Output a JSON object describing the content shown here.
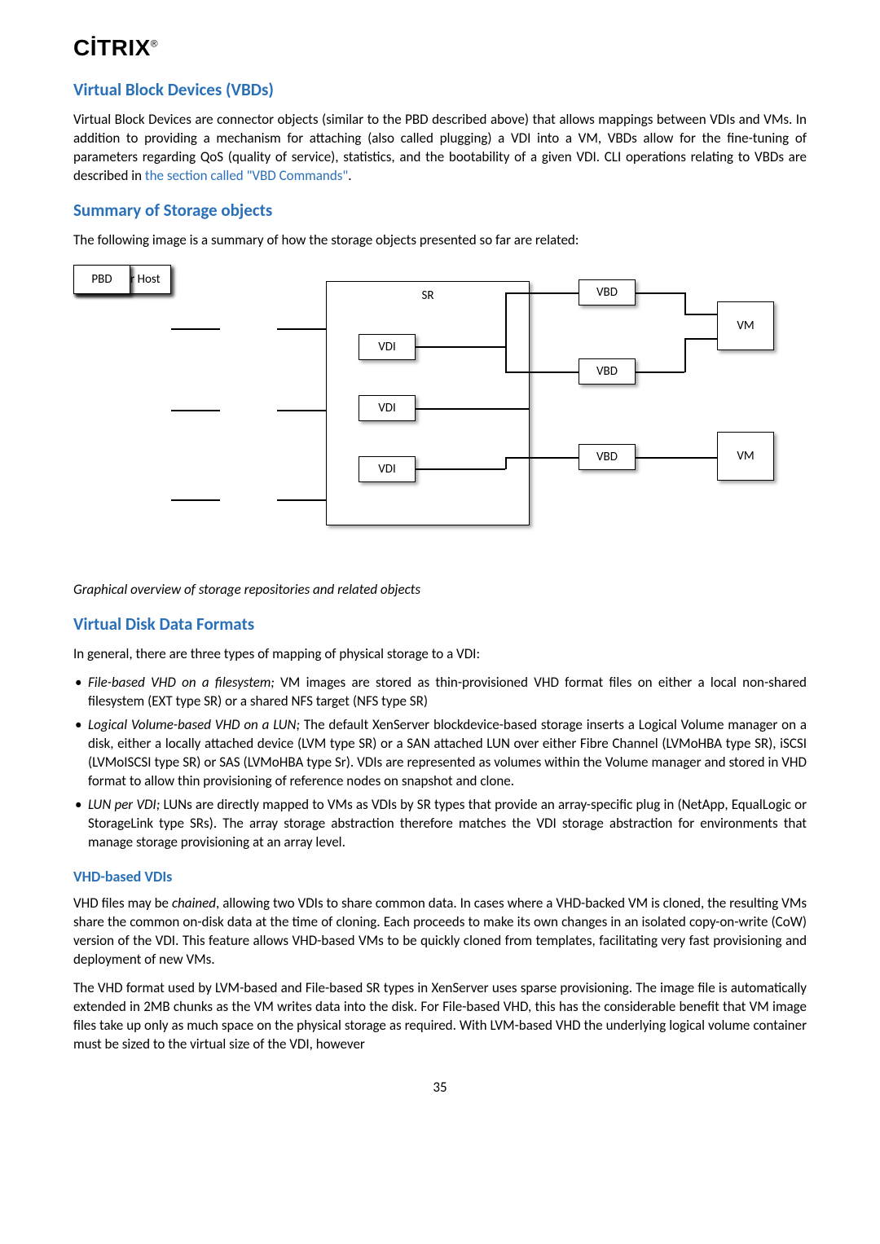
{
  "brand": "CİTRIX",
  "brand_reg": "®",
  "sections": {
    "vbd": {
      "title": "Virtual Block Devices (VBDs)",
      "p1a": "Virtual Block Devices are connector objects (similar to the PBD described above) that allows mappings between VDIs and VMs. In addition to providing a mechanism for attaching (also called plugging) a VDI into a VM, VBDs allow for the fine-tuning of parameters regarding QoS (quality of service), statistics, and the bootability of a given VDI. CLI operations relating to VBDs are described in ",
      "p1link": "the section called \"VBD Commands\"",
      "p1b": "."
    },
    "summary": {
      "title": "Summary of Storage objects",
      "p1": "The following image is a summary of how the storage objects presented so far are related:"
    },
    "caption": "Graphical overview of storage repositories and related objects",
    "vdd": {
      "title": "Virtual Disk Data Formats",
      "p1": "In general, there are three types of mapping of physical storage to a VDI:",
      "b1_em": "File-based VHD on a filesystem;",
      "b1": " VM images are stored as thin-provisioned VHD format files on either a local non-shared filesystem (EXT type SR) or a shared NFS target (NFS type SR)",
      "b2_em": "Logical Volume-based VHD on a LUN;",
      "b2": " The default XenServer blockdevice-based storage inserts a Logical Volume manager on a disk, either a locally attached device (LVM type SR) or a SAN attached LUN over either Fibre Channel (LVMoHBA type SR), iSCSI (LVMoISCSI type SR) or SAS (LVMoHBA type Sr). VDIs are represented as volumes within the Volume manager and stored in VHD format to allow thin provisioning of reference nodes on snapshot and clone.",
      "b3_em": "LUN per VDI;",
      "b3": " LUNs are directly mapped to VMs as VDIs by SR types that provide an array-specific plug in (NetApp, EqualLogic or StorageLink type SRs). The array storage abstraction therefore matches the VDI storage abstraction for environments that manage storage provisioning at an array level."
    },
    "vhd": {
      "title": "VHD-based VDIs",
      "p1a": "VHD files may be ",
      "p1em": "chained",
      "p1b": ", allowing two VDIs to share common data. In cases where a VHD-backed VM is cloned, the resulting VMs share the common on-disk data at the time of cloning. Each proceeds to make its own changes in an isolated copy-on-write (CoW) version of the VDI. This feature allows VHD-based VMs to be quickly cloned from templates, facilitating very fast provisioning and deployment of new VMs.",
      "p2": "The VHD format used by LVM-based and File-based SR types in XenServer uses sparse provisioning. The image file is automatically extended in 2MB chunks as the VM writes data into the disk. For File-based VHD, this has the considerable benefit that VM image files take up only as much space on the physical storage as required. With LVM-based VHD the underlying logical volume container must be sized to the virtual size of the VDI, however"
    }
  },
  "diagram": {
    "xenserver": "XenServer Host",
    "pbd": "PBD",
    "sr": "SR",
    "vdi": "VDI",
    "vbd": "VBD",
    "vm": "VM"
  },
  "page": "35"
}
